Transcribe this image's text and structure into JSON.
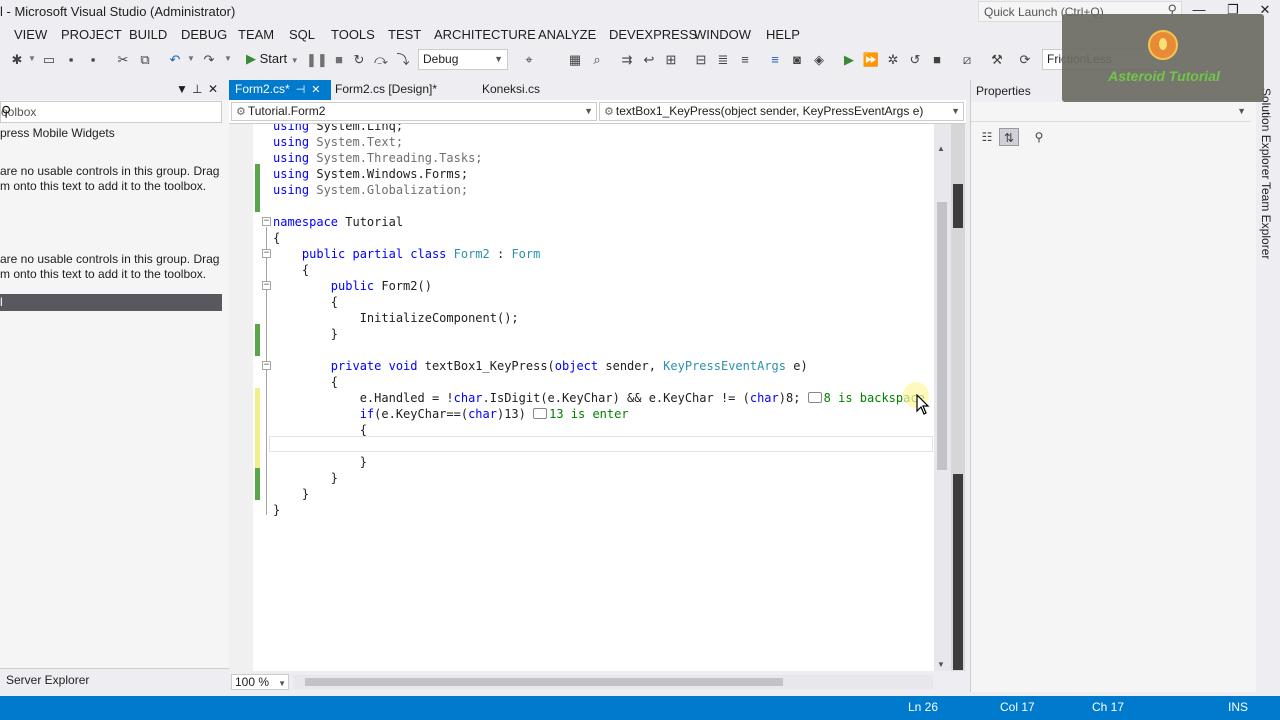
{
  "window": {
    "title": "l - Microsoft Visual Studio (Administrator)",
    "quick_launch_placeholder": "Quick Launch (Ctrl+Q)",
    "minimize": "—",
    "restore": "❐",
    "close": "✕"
  },
  "menu": [
    "VIEW",
    "PROJECT",
    "BUILD",
    "DEBUG",
    "TEAM",
    "SQL",
    "TOOLS",
    "TEST",
    "ARCHITECTURE",
    "ANALYZE",
    "DEVEXPRESS",
    "WINDOW",
    "HELP"
  ],
  "toolbar": {
    "start_label": "Start",
    "config": "Debug",
    "search_value": "FrictionLess"
  },
  "logo": {
    "text": "Asteroid Tutorial"
  },
  "toolbox": {
    "title": "oolbox",
    "search_placeholder": "oolbox",
    "group1": "press Mobile Widgets",
    "note1": "are no usable controls in this group. Drag\nm onto this text to add it to the toolbox.",
    "group2": "l",
    "note2": "are no usable controls in this group. Drag\nm onto this text to add it to the toolbox.",
    "server_explorer": "Server Explorer"
  },
  "doc_tabs": [
    {
      "label": "Form2.cs*",
      "active": true
    },
    {
      "label": "Form2.cs [Design]*",
      "active": false
    },
    {
      "label": "Koneksi.cs",
      "active": false
    }
  ],
  "nav": {
    "class_select": "Tutorial.Form2",
    "member_select": "textBox1_KeyPress(object sender, KeyPressEventArgs e)"
  },
  "code": {
    "l1_kw": "using",
    "l1_ns": " System.Linq;",
    "l2_kw": "using",
    "l2_ns": " System.Text;",
    "l3_kw": "using",
    "l3_ns": " System.Threading.Tasks;",
    "l4_kw": "using",
    "l4_ns": " System.Windows.Forms;",
    "l5_kw": "using",
    "l5_ns": " System.Globalization;",
    "l6_kw": "namespace",
    "l6_rest": " Tutorial",
    "l7": "{",
    "l8_a": "    public partial class",
    "l8_b": " Form2",
    "l8_c": " : ",
    "l8_d": "Form",
    "l9": "    {",
    "l10_a": "        public",
    "l10_b": " Form2()",
    "l11": "        {",
    "l12": "            InitializeComponent();",
    "l13": "        }",
    "l14_a": "        private void",
    "l14_b": " textBox1_KeyPress(",
    "l14_c": "object",
    "l14_d": " sender, ",
    "l14_e": "KeyPressEventArgs",
    "l14_f": " e)",
    "l15": "        {",
    "l16_a": "            e.Handled = !",
    "l16_b": "char",
    "l16_c": ".IsDigit(e.KeyChar) && e.KeyChar != (",
    "l16_d": "char",
    "l16_e": ")8; ",
    "l16_f": "8 is backspace",
    "l17_a": "            ",
    "l17_b": "if",
    "l17_c": "(e.KeyChar==(",
    "l17_d": "char",
    "l17_e": ")13) ",
    "l17_f": "13 is enter",
    "l18": "            {",
    "l19": "",
    "l20": "            }",
    "l21": "        }",
    "l22": "    }",
    "l23": "}"
  },
  "zoom": "100 %",
  "properties": {
    "title": "Properties"
  },
  "right_tabs": [
    "Solution Explorer",
    "Team Explorer"
  ],
  "status": {
    "ln": "Ln 26",
    "col": "Col 17",
    "ch": "Ch 17",
    "mode": "INS"
  },
  "colors": {
    "accent": "#007acc",
    "keyword": "#0000ff",
    "type": "#2b91af",
    "comment": "#008000"
  }
}
